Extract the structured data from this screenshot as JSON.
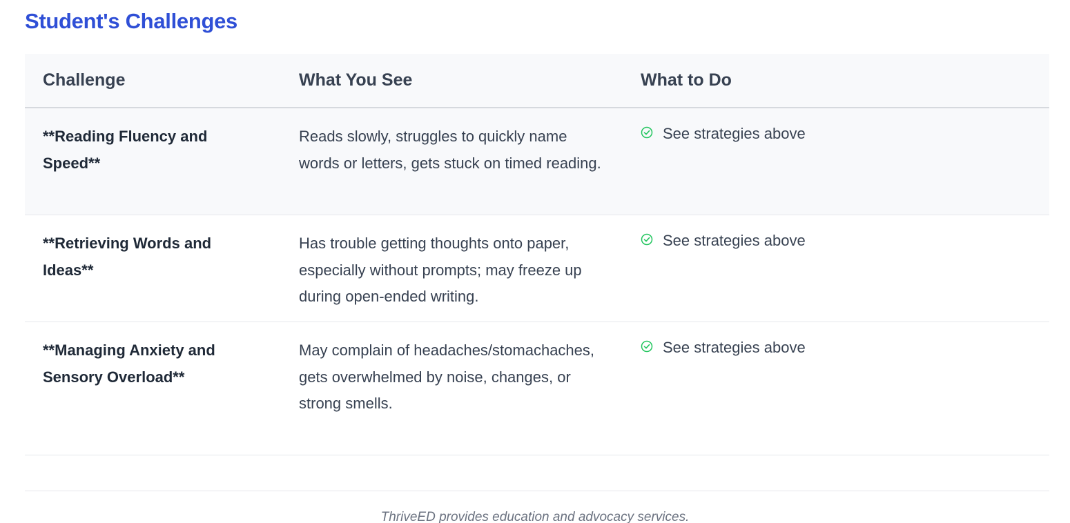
{
  "page": {
    "section_title": "Student's Challenges",
    "footer": "ThriveED provides education and advocacy services."
  },
  "table": {
    "headers": [
      "Challenge",
      "What You See",
      "What to Do"
    ],
    "rows": [
      {
        "challenge": "**Reading Fluency and Speed**",
        "what_you_see": "Reads slowly, struggles to quickly name words or letters, gets stuck on timed reading.",
        "what_to_do": "See strategies above"
      },
      {
        "challenge": "**Retrieving Words and Ideas**",
        "what_you_see": "Has trouble getting thoughts onto paper, especially without prompts; may freeze up during open-ended writing.",
        "what_to_do": "See strategies above"
      },
      {
        "challenge": "**Managing Anxiety and Sensory Overload**",
        "what_you_see": "May complain of headaches/stomachaches, gets overwhelmed by noise, changes, or strong smells.",
        "what_to_do": "See strategies above"
      }
    ]
  },
  "colors": {
    "title": "#2f4fd6",
    "check_icon": "#22c55e",
    "header_bg": "#f8f9fb"
  },
  "icons": {
    "action": "check-circle-icon"
  }
}
